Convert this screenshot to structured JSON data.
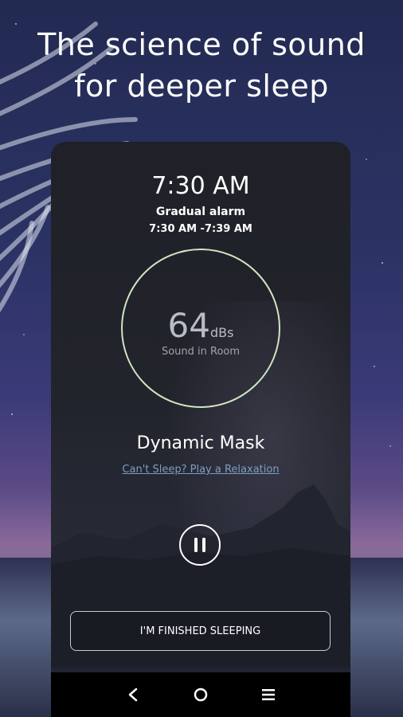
{
  "headline": {
    "line1": "The science of sound",
    "line2": "for deeper sleep"
  },
  "alarm": {
    "time": "7:30 AM",
    "label": "Gradual alarm",
    "range": "7:30 AM -7:39 AM"
  },
  "sound_meter": {
    "value": "64",
    "unit": "dBs",
    "caption": "Sound in Room"
  },
  "mode": {
    "title": "Dynamic Mask",
    "relax_link": "Can't Sleep? Play a Relaxation"
  },
  "controls": {
    "pause_icon": "pause-icon",
    "finish_label": "I'M FINISHED SLEEPING"
  },
  "navbar": {
    "back_icon": "back-icon",
    "home_icon": "home-icon",
    "menu_icon": "menu-icon"
  },
  "colors": {
    "ring": "#cfe6c2",
    "link": "#7d9ec2",
    "navbar": "#000000"
  }
}
